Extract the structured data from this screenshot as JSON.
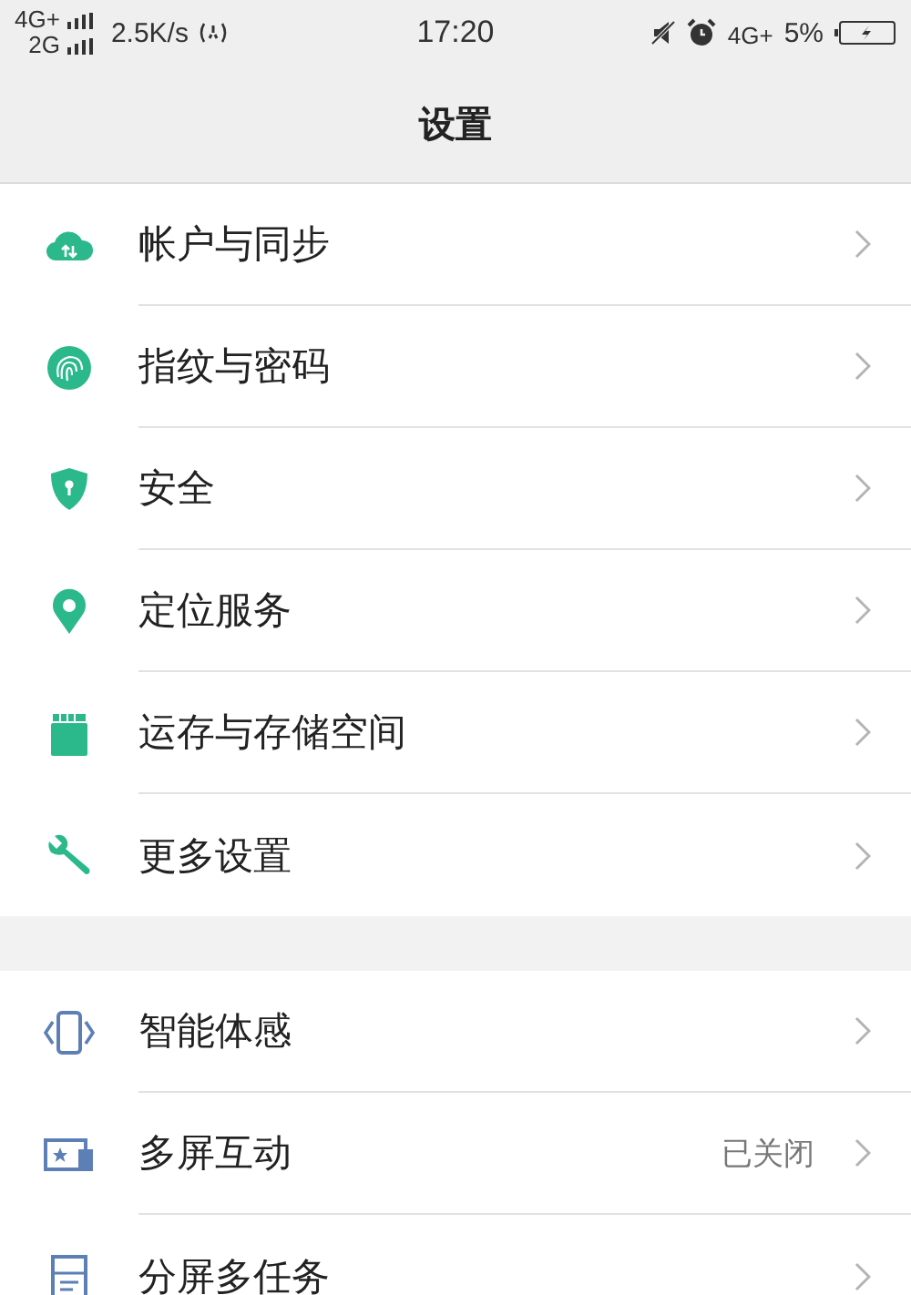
{
  "status_bar": {
    "sim1": "4G+",
    "sim2": "2G",
    "speed": "2.5K/s",
    "time": "17:20",
    "network": "4G+",
    "battery": "5%"
  },
  "title": "设置",
  "groups": [
    {
      "items": [
        {
          "label": "帐户与同步"
        },
        {
          "label": "指纹与密码"
        },
        {
          "label": "安全"
        },
        {
          "label": "定位服务"
        },
        {
          "label": "运存与存储空间"
        },
        {
          "label": "更多设置"
        }
      ]
    },
    {
      "items": [
        {
          "label": "智能体感"
        },
        {
          "label": "多屏互动",
          "value": "已关闭"
        },
        {
          "label": "分屏多任务"
        }
      ]
    }
  ]
}
